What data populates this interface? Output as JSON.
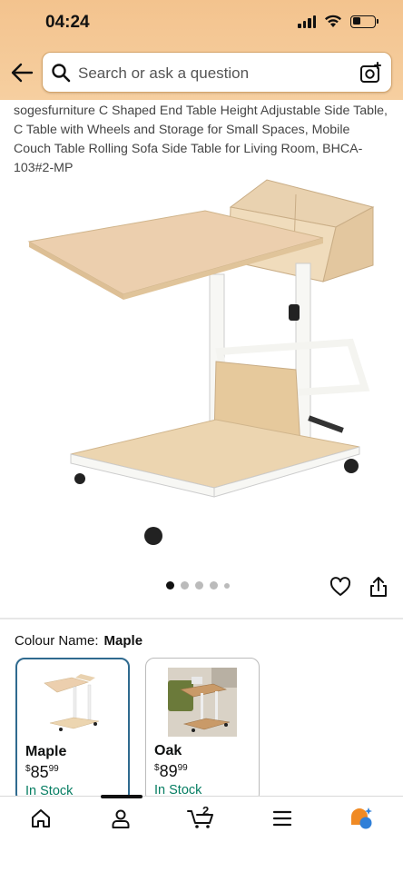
{
  "status_bar": {
    "time": "04:24"
  },
  "search": {
    "placeholder": "Search or ask a question"
  },
  "product": {
    "title": "sogesfurniture C Shaped End Table Height Adjustable Side Table, C Table with Wheels and Storage for Small Spaces, Mobile Couch Table Rolling Sofa Side Table for Living Room, BHCA-103#2-MP",
    "image_pages": {
      "total": 5,
      "current": 1
    }
  },
  "colour": {
    "label": "Colour Name:",
    "selected": "Maple",
    "options": [
      {
        "name": "Maple",
        "price_symbol": "$",
        "price_whole": "85",
        "price_fraction": "99",
        "stock": "In Stock",
        "selected": true
      },
      {
        "name": "Oak",
        "price_symbol": "$",
        "price_whole": "89",
        "price_fraction": "99",
        "stock": "In Stock",
        "selected": false
      }
    ]
  },
  "nav": {
    "items": [
      "home-icon",
      "account-icon",
      "cart-icon",
      "menu-icon",
      "assistant-icon"
    ],
    "cart_count": "2"
  },
  "colors": {
    "header": "#f3c38e",
    "selected_border": "#2f6a8f",
    "in_stock": "#067d62"
  }
}
